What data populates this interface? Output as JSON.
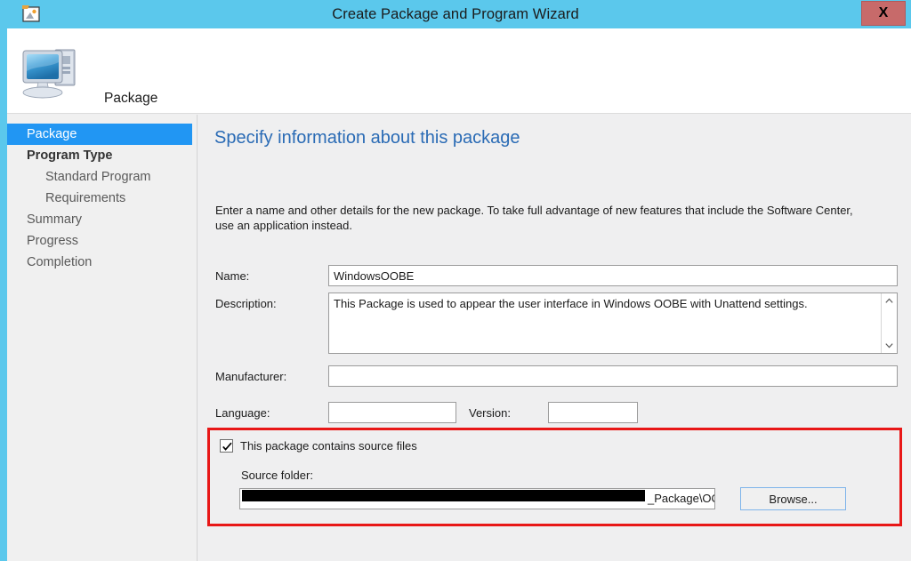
{
  "window": {
    "title": "Create Package and Program Wizard",
    "close_label": "X",
    "app_icon": "package-wizard-icon",
    "titlebar_color": "#5bc8ec"
  },
  "header": {
    "icon": "computer-icon",
    "title": "Package"
  },
  "sidebar": {
    "items": [
      {
        "label": "Package",
        "state": "selected",
        "indent": 0
      },
      {
        "label": "Program Type",
        "state": "bold",
        "indent": 0
      },
      {
        "label": "Standard Program",
        "state": "normal",
        "indent": 1
      },
      {
        "label": "Requirements",
        "state": "normal",
        "indent": 1
      },
      {
        "label": "Summary",
        "state": "normal",
        "indent": 0
      },
      {
        "label": "Progress",
        "state": "normal",
        "indent": 0
      },
      {
        "label": "Completion",
        "state": "normal",
        "indent": 0
      }
    ],
    "selected_color": "#2196f3"
  },
  "main": {
    "heading": "Specify information about this package",
    "heading_color": "#2a6bb5",
    "description": "Enter a name and other details for the new package. To take full advantage of new features that include the Software Center, use an application instead.",
    "fields": {
      "name_label": "Name:",
      "name_value": "WindowsOOBE",
      "description_label": "Description:",
      "description_value": "This Package is used to appear the user interface in Windows OOBE with Unattend settings.",
      "manufacturer_label": "Manufacturer:",
      "manufacturer_value": "",
      "language_label": "Language:",
      "language_value": "",
      "version_label": "Version:",
      "version_value": ""
    },
    "source_section": {
      "highlight_color": "#e81717",
      "checkbox_label": "This package contains source files",
      "checkbox_checked": true,
      "source_folder_label": "Source folder:",
      "source_folder_value": "_Package\\OOBE",
      "source_folder_redacted": true,
      "browse_label": "Browse..."
    },
    "scrollbar": {
      "up_arrow": "chevron-up-icon",
      "down_arrow": "chevron-down-icon"
    }
  }
}
